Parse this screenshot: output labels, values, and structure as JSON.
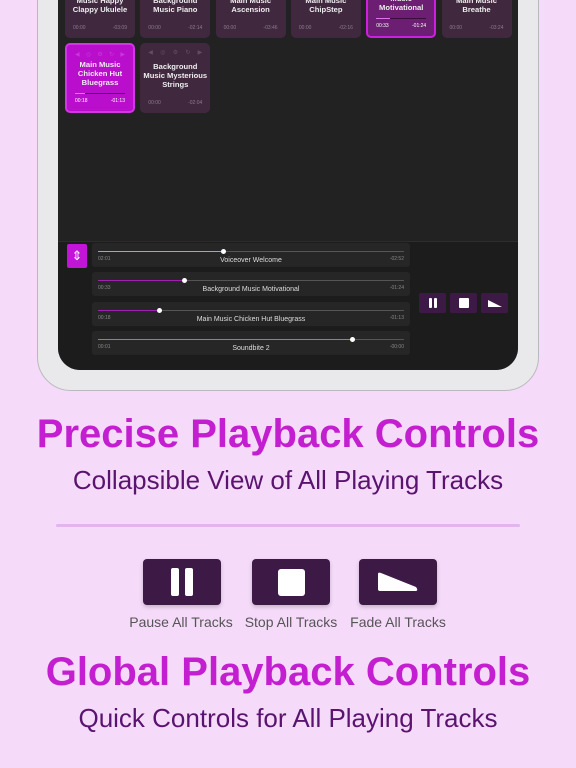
{
  "tiles": [
    {
      "title": "Music Happy Clappy Ukulele",
      "elapsed": "00:00",
      "remaining": "-03:09",
      "state": "idle"
    },
    {
      "title": "Background Music Piano",
      "elapsed": "00:00",
      "remaining": "-02:14",
      "state": "idle"
    },
    {
      "title": "Main Music Ascension",
      "elapsed": "00:00",
      "remaining": "-03:46",
      "state": "idle"
    },
    {
      "title": "Main Music ChipStep",
      "elapsed": "00:00",
      "remaining": "-02:16",
      "state": "idle"
    },
    {
      "title": "Background Music Motivational",
      "elapsed": "00:33",
      "remaining": "-01:24",
      "state": "playing",
      "progress": 0.28
    },
    {
      "title": "Main Music Breathe",
      "elapsed": "00:00",
      "remaining": "-03:24",
      "state": "idle"
    },
    {
      "title": "Main Music Chicken Hut Bluegrass",
      "elapsed": "00:18",
      "remaining": "-01:13",
      "state": "highlighted",
      "progress": 0.2
    },
    {
      "title": "Background Music Mysterious Strings",
      "elapsed": "00:00",
      "remaining": "-02:04",
      "state": "idle"
    }
  ],
  "playing": [
    {
      "name": "Voiceover Welcome",
      "elapsed": "02:01",
      "remaining": "-02:52",
      "progress": 0.41,
      "color": "#e0a030"
    },
    {
      "name": "Background Music Motivational",
      "elapsed": "00:33",
      "remaining": "-01:24",
      "progress": 0.28,
      "color": "#a020b0"
    },
    {
      "name": "Main Music Chicken Hut Bluegrass",
      "elapsed": "00:18",
      "remaining": "-01:13",
      "progress": 0.2,
      "color": "#a020b0"
    },
    {
      "name": "Soundbite 2",
      "elapsed": "00:01",
      "remaining": "-00:00",
      "progress": 0.83,
      "color": "#5fb020"
    }
  ],
  "headline1": "Precise Playback Controls",
  "subhead1": "Collapsible View of All Playing Tracks",
  "buttons": {
    "pause": "Pause All Tracks",
    "stop": "Stop All Tracks",
    "fade": "Fade All Tracks"
  },
  "headline2": "Global Playback Controls",
  "subhead2": "Quick Controls for All Playing Tracks",
  "colors": {
    "accent": "#c31ecf",
    "button": "#3d1a45",
    "background": "#f5dbf9"
  }
}
